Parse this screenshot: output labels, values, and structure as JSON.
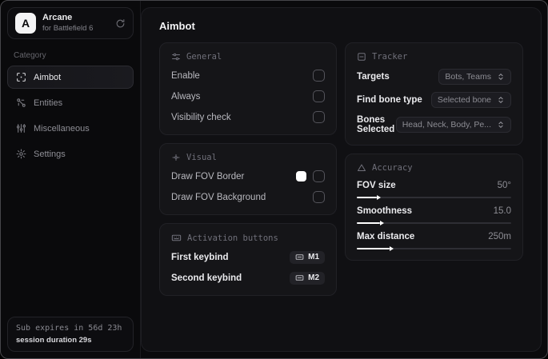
{
  "sidebar": {
    "brand": {
      "logo_letter": "A",
      "name": "Arcane",
      "subtitle": "for Battlefield 6"
    },
    "category_label": "Category",
    "items": [
      {
        "label": "Aimbot",
        "icon": "crosshair-icon",
        "selected": true
      },
      {
        "label": "Entities",
        "icon": "entities-icon",
        "selected": false
      },
      {
        "label": "Miscellaneous",
        "icon": "sliders-vertical-icon",
        "selected": false
      },
      {
        "label": "Settings",
        "icon": "gear-icon",
        "selected": false
      }
    ],
    "subscription": {
      "expires_text": "Sub expires in 56d 23h",
      "session_text": "session duration 29s"
    }
  },
  "main": {
    "title": "Aimbot",
    "cards": {
      "general": {
        "title": "General",
        "rows": [
          {
            "label": "Enable",
            "control": "checkbox",
            "checked": false
          },
          {
            "label": "Always",
            "control": "checkbox",
            "checked": false
          },
          {
            "label": "Visibility check",
            "control": "checkbox",
            "checked": false
          }
        ]
      },
      "visual": {
        "title": "Visual",
        "rows": [
          {
            "label": "Draw FOV Border",
            "control": "color+checkbox",
            "swatch_color": "#ffffff",
            "checked": false
          },
          {
            "label": "Draw FOV Background",
            "control": "checkbox",
            "checked": false
          }
        ]
      },
      "activation": {
        "title": "Activation buttons",
        "rows": [
          {
            "label": "First keybind",
            "key": "M1"
          },
          {
            "label": "Second keybind",
            "key": "M2"
          }
        ]
      },
      "tracker": {
        "title": "Tracker",
        "rows": [
          {
            "label": "Targets",
            "value": "Bots, Teams"
          },
          {
            "label": "Find bone type",
            "value": "Selected bone"
          },
          {
            "label": "Bones Selected",
            "value": "Head, Neck, Body, Pe..."
          }
        ]
      },
      "accuracy": {
        "title": "Accuracy",
        "sliders": [
          {
            "label": "FOV size",
            "value": "50°",
            "fill": "13%"
          },
          {
            "label": "Smoothness",
            "value": "15.0",
            "fill": "15%"
          },
          {
            "label": "Max distance",
            "value": "250m",
            "fill": "21%"
          }
        ]
      }
    }
  },
  "colors": {
    "panel_bg": "#101013",
    "card_bg": "#151518",
    "swatch_white": "#ffffff"
  }
}
